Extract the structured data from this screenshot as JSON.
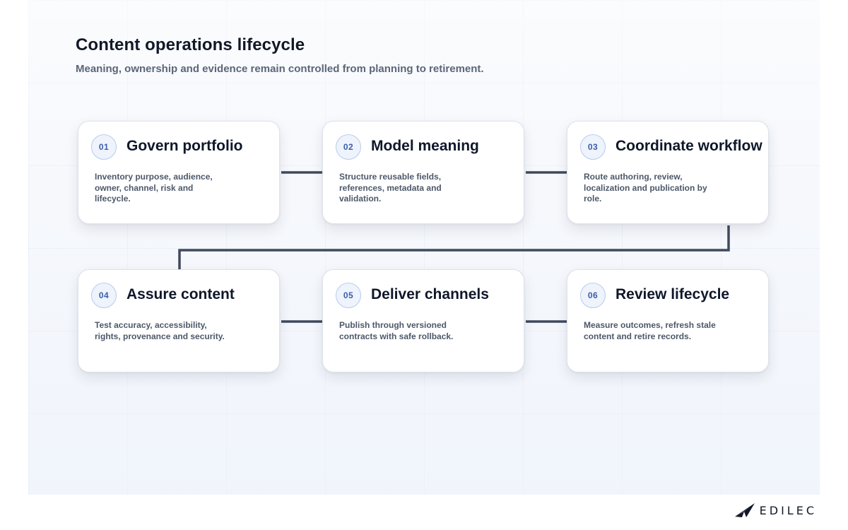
{
  "header": {
    "title": "Content operations lifecycle",
    "subtitle": "Meaning, ownership and evidence remain controlled from planning to retirement."
  },
  "steps": [
    {
      "number": "01",
      "title": "Govern portfolio",
      "description": "Inventory purpose, audience, owner, channel, risk and lifecycle."
    },
    {
      "number": "02",
      "title": "Model meaning",
      "description": "Structure reusable fields, references, metadata and validation."
    },
    {
      "number": "03",
      "title": "Coordinate workflow",
      "description": "Route authoring, review, localization and publication by role."
    },
    {
      "number": "04",
      "title": "Assure content",
      "description": "Test accuracy, accessibility, rights, provenance and security."
    },
    {
      "number": "05",
      "title": "Deliver channels",
      "description": "Publish through versioned contracts with safe rollback."
    },
    {
      "number": "06",
      "title": "Review lifecycle",
      "description": "Measure outcomes, refresh stale content and retire records."
    }
  ],
  "brand": {
    "name": "EDILEC",
    "logo_icon": "paper-plane-wing-icon"
  },
  "colors": {
    "connector": "#3f4a5c",
    "badge_text": "#3a5ea8",
    "badge_border": "#b9cbec"
  }
}
